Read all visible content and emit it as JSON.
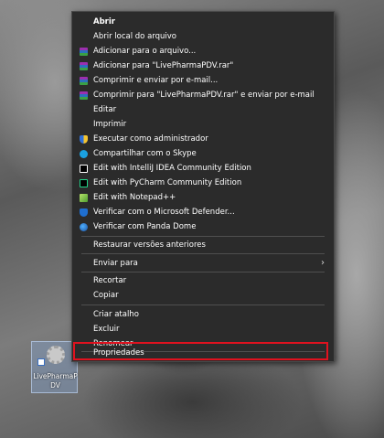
{
  "context_menu": {
    "items": [
      {
        "label": "Abrir",
        "icon": "",
        "bold": true
      },
      {
        "label": "Abrir local do arquivo",
        "icon": ""
      },
      {
        "label": "Adicionar para o arquivo...",
        "icon": "winrar-icon"
      },
      {
        "label": "Adicionar para \"LivePharmaPDV.rar\"",
        "icon": "winrar-icon"
      },
      {
        "label": "Comprimir e enviar por e-mail...",
        "icon": "winrar-icon"
      },
      {
        "label": "Comprimir para \"LivePharmaPDV.rar\" e enviar por e-mail",
        "icon": "winrar-icon"
      },
      {
        "label": "Editar",
        "icon": ""
      },
      {
        "label": "Imprimir",
        "icon": ""
      },
      {
        "label": "Executar como administrador",
        "icon": "uac-shield-icon"
      },
      {
        "label": "Compartilhar com o Skype",
        "icon": "skype-icon"
      },
      {
        "label": "Edit with IntelliJ IDEA Community Edition",
        "icon": "intellij-icon"
      },
      {
        "label": "Edit with PyCharm Community Edition",
        "icon": "pycharm-icon"
      },
      {
        "label": "Edit with Notepad++",
        "icon": "notepadpp-icon"
      },
      {
        "label": "Verificar com o Microsoft Defender...",
        "icon": "defender-icon"
      },
      {
        "label": "Verificar com Panda Dome",
        "icon": "panda-icon"
      },
      {
        "label": "Restaurar versões anteriores",
        "icon": ""
      },
      {
        "label": "Enviar para",
        "icon": "",
        "submenu": true
      },
      {
        "label": "Recortar",
        "icon": ""
      },
      {
        "label": "Copiar",
        "icon": ""
      },
      {
        "label": "Criar atalho",
        "icon": ""
      },
      {
        "label": "Excluir",
        "icon": ""
      },
      {
        "label": "Renomear",
        "icon": ""
      },
      {
        "label": "Propriedades",
        "icon": ""
      }
    ],
    "submenu_arrow": "›"
  },
  "desktop_icon": {
    "label": "LivePharmaPDV",
    "icon": "gear-shortcut-icon"
  },
  "colors": {
    "menu_bg": "#2b2b2b",
    "menu_text": "#ffffff",
    "separator": "#4f4f4f",
    "highlight_border": "#e0121f"
  }
}
